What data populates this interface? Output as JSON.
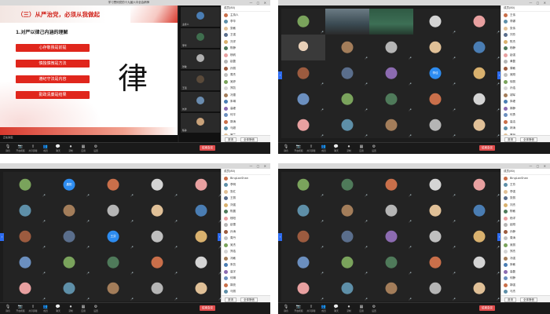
{
  "quads": {
    "q1": {
      "title": "学习贯彻党的十九届六中全会精神",
      "participants_header": "成员(80)",
      "participants": [
        "主持人",
        "李华",
        "张敏",
        "王强",
        "刘洋",
        "陈静",
        "杨帆",
        "赵磊",
        "孙丽",
        "周杰",
        "吴婷",
        "郑凯",
        "冯雪",
        "朱琳",
        "高峰",
        "何平",
        "郭涛",
        "马超",
        "罗兰",
        "梁晨"
      ],
      "slide": {
        "title": "（三）从严治党，必须从我做起",
        "subtitle": "1.对严以律己内涵的理解",
        "items": [
          "心存敬畏是前提",
          "慎独慎微是方法",
          "遵纪守法是内容",
          "勤政清廉是结果"
        ],
        "glyph": "律"
      },
      "strip": [
        "主持人",
        "李华",
        "张敏",
        "王强",
        "刘洋",
        "陈静"
      ],
      "status": "正在讲话："
    },
    "q2": {
      "view_label": "宫格视图",
      "participants_header": "成员(80)",
      "participants": [
        "王伟",
        "李娜",
        "张伟",
        "刘芳",
        "陈杰",
        "杨静",
        "赵强",
        "黄磊",
        "周敏",
        "吴刚",
        "徐丽",
        "孙浩",
        "胡军",
        "朱峰",
        "郭静",
        "何勇",
        "高洁",
        "林涛",
        "罗丹",
        "梁宇"
      ],
      "tiles": [
        "",
        "",
        "",
        "",
        "",
        "",
        "",
        "",
        "",
        "",
        "",
        "",
        "",
        "",
        "",
        "",
        "",
        "",
        "",
        "",
        "",
        "",
        "",
        "",
        "",
        ""
      ]
    },
    "q3": {
      "view_label": "宫格视图",
      "participants_header": "成员(80)",
      "participants": [
        "BingLanShan",
        "李明",
        "张红",
        "王丽",
        "刘强",
        "陈晨",
        "杨阳",
        "赵雪",
        "孙涛",
        "周丹",
        "吴杰",
        "郑浩",
        "冯敏",
        "朱凯",
        "高宇",
        "何琳",
        "郭亮",
        "马丽",
        "罗杰",
        "梁静"
      ],
      "tiles": [
        "",
        "",
        "",
        "",
        "",
        "",
        "",
        "",
        "",
        "",
        "",
        "",
        "",
        "",
        "",
        "",
        "",
        "",
        "",
        "",
        "",
        "",
        "",
        "",
        ""
      ]
    },
    "q4": {
      "view_label": "宫格视图",
      "participants_header": "成员(80)",
      "participants": [
        "BingLanShan",
        "王芳",
        "李强",
        "张丽",
        "刘杰",
        "陈敏",
        "杨洋",
        "赵刚",
        "孙静",
        "周涛",
        "吴丽",
        "郑杰",
        "冯强",
        "朱敏",
        "高磊",
        "何静",
        "郭强",
        "马杰",
        "罗敏",
        "梁丽"
      ],
      "tiles": [
        "",
        "",
        "",
        "",
        "",
        "",
        "",
        "",
        "",
        "",
        "",
        "",
        "",
        "",
        "",
        "",
        "",
        "",
        "",
        "",
        "",
        "",
        "",
        "",
        ""
      ]
    }
  },
  "toolbar": {
    "items": [
      "静音",
      "开启视频",
      "共享屏幕",
      "成员",
      "聊天",
      "录制",
      "应用",
      "设置"
    ],
    "icons": [
      "mic-icon",
      "camera-icon",
      "share-screen-icon",
      "participants-icon",
      "chat-icon",
      "record-icon",
      "apps-icon",
      "settings-icon"
    ],
    "end_label": "结束会议"
  },
  "side_footer": {
    "invite": "邀请",
    "mute_all": "全体静音"
  },
  "named_tiles": {
    "q2_a": "李佳",
    "q3_a": "晨阳",
    "q3_b": "王芬"
  },
  "colors": {
    "accent": "#2d8cf0",
    "end": "#e04b4b",
    "slide_red": "#e0261c"
  }
}
